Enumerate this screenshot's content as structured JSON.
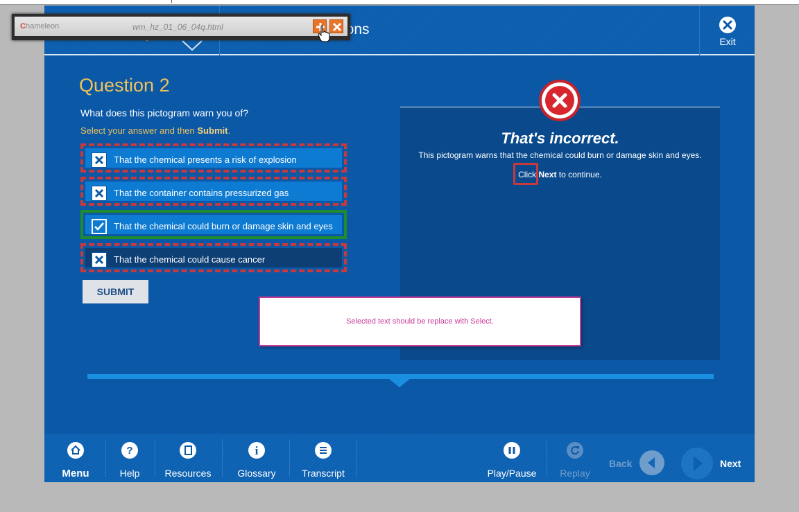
{
  "toolbar": {
    "logo_initial": "C",
    "logo_rest": "hameleon",
    "filename": "wm_hz_01_06_04q.html"
  },
  "header": {
    "title": "cations",
    "exit_label": "Exit"
  },
  "question": {
    "title": "Question 2",
    "text": "What does this pictogram warn you of?",
    "instruction_pre": "Select your answer and then ",
    "instruction_bold": "Submit",
    "instruction_post": ".",
    "options": [
      {
        "text": "That the chemical presents a risk of explosion",
        "state": "incorrect"
      },
      {
        "text": "That the container contains pressurized gas",
        "state": "incorrect"
      },
      {
        "text": "That the chemical could burn or damage skin and eyes",
        "state": "correct"
      },
      {
        "text": "That the chemical could cause cancer",
        "state": "incorrect"
      }
    ],
    "submit_label": "SUBMIT"
  },
  "feedback": {
    "title": "That's incorrect.",
    "body": "This pictogram warns that the chemical could burn or damage skin and eyes.",
    "click_pre": "Click ",
    "click_bold": "Next",
    "click_post": " to continue."
  },
  "note": {
    "text": "Selected text should be replace with Select."
  },
  "bottom_nav": {
    "menu": "Menu",
    "help": "Help",
    "resources": "Resources",
    "glossary": "Glossary",
    "transcript": "Transcript",
    "play_pause": "Play/Pause",
    "replay": "Replay",
    "back": "Back",
    "next": "Next"
  },
  "colors": {
    "frame_blue": "#0b58a6",
    "accent_gold": "#f0c35a",
    "incorrect_red": "#c8393c",
    "correct_green": "#1f8c2e",
    "note_magenta": "#c8389b"
  }
}
